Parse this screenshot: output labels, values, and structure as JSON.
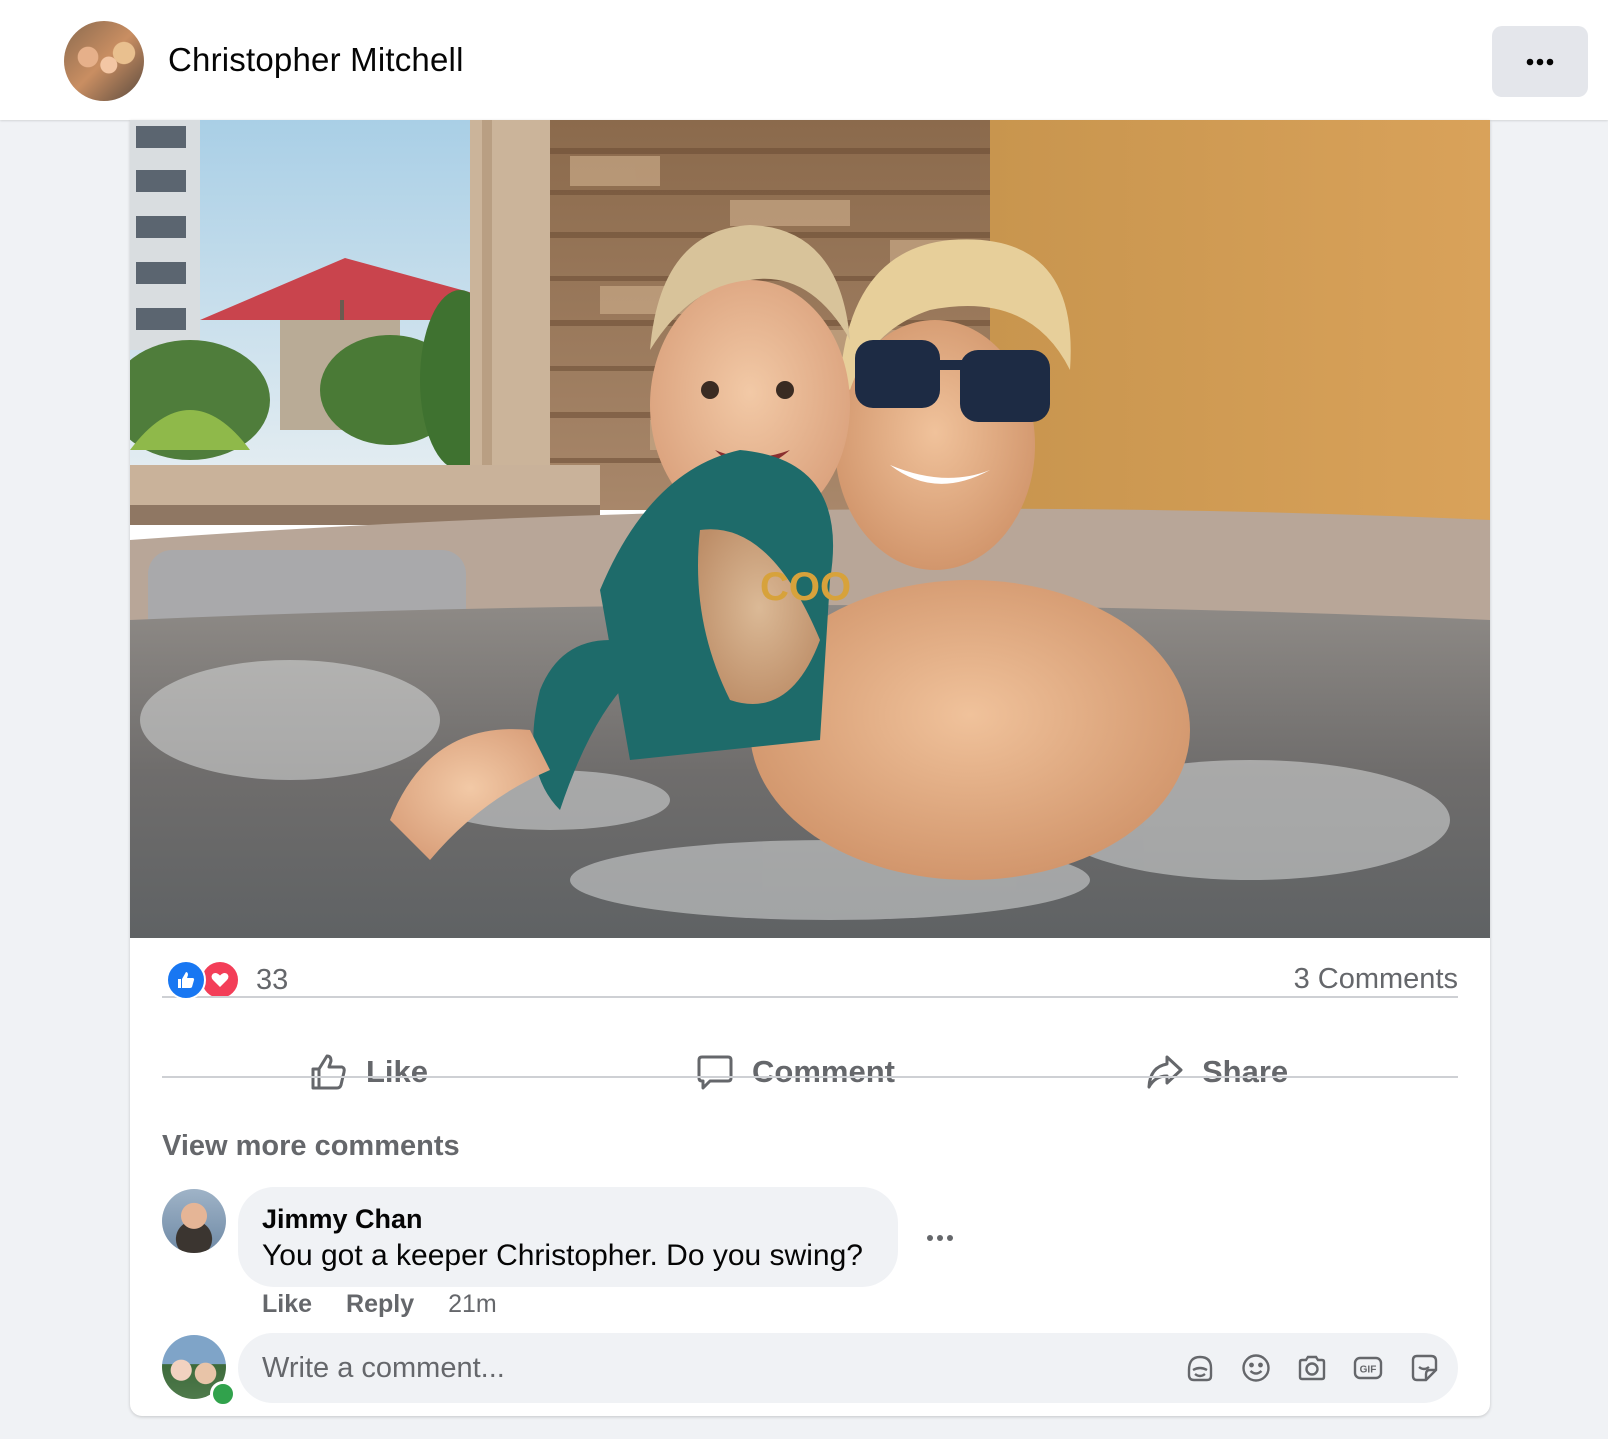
{
  "post": {
    "author_name": "Christopher Mitchell",
    "reactions_count": "33",
    "comments_count": "3 Comments"
  },
  "actions": {
    "like": "Like",
    "comment": "Comment",
    "share": "Share"
  },
  "comments": {
    "view_more": "View more comments",
    "items": [
      {
        "author": "Jimmy Chan",
        "text": "You got a keeper Christopher. Do you swing?",
        "like": "Like",
        "reply": "Reply",
        "time": "21m"
      }
    ]
  },
  "composer": {
    "placeholder": "Write a comment..."
  },
  "icons": [
    "more-options-icon",
    "like-reaction-icon",
    "love-reaction-icon",
    "thumbs-up-icon",
    "comment-bubble-icon",
    "share-arrow-icon",
    "avatar-sticker-icon",
    "emoji-icon",
    "camera-icon",
    "gif-icon",
    "sticker-icon"
  ],
  "colors": {
    "like_blue": "#1877f2",
    "love_red": "#f33e58",
    "secondary_text": "#65676b",
    "online_green": "#31a24c"
  }
}
